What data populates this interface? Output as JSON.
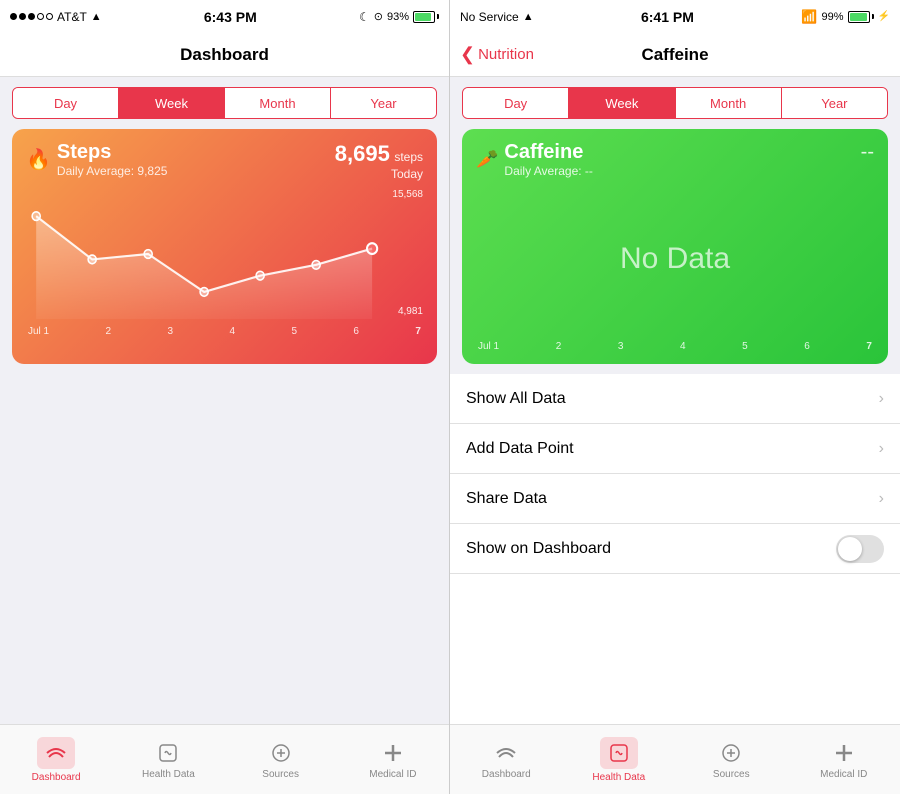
{
  "left": {
    "status": {
      "carrier": "AT&T",
      "time": "6:43 PM",
      "battery_pct": 93,
      "moon": true,
      "wifi": true
    },
    "header": {
      "title": "Dashboard"
    },
    "segments": [
      "Day",
      "Week",
      "Month",
      "Year"
    ],
    "active_segment": "Week",
    "card": {
      "icon": "🔥",
      "title": "Steps",
      "daily_avg_label": "Daily Average:",
      "daily_avg_value": "9,825",
      "value": "8,695",
      "unit": "steps",
      "date": "Today",
      "high_label": "15,568",
      "low_label": "4,981",
      "x_labels": [
        "Jul 1",
        "2",
        "3",
        "4",
        "5",
        "6",
        "7"
      ]
    },
    "tabs": [
      {
        "id": "dashboard",
        "label": "Dashboard",
        "active": true
      },
      {
        "id": "health-data",
        "label": "Health Data",
        "active": false
      },
      {
        "id": "sources",
        "label": "Sources",
        "active": false
      },
      {
        "id": "medical-id",
        "label": "Medical ID",
        "active": false
      }
    ]
  },
  "right": {
    "status": {
      "carrier": "No Service",
      "time": "6:41 PM",
      "battery_pct": 99,
      "bluetooth": true,
      "wifi": true
    },
    "nav": {
      "back_label": "Nutrition",
      "title": "Caffeine"
    },
    "segments": [
      "Day",
      "Week",
      "Month",
      "Year"
    ],
    "active_segment": "Week",
    "card": {
      "icon": "🥕",
      "title": "Caffeine",
      "daily_avg_label": "Daily Average:",
      "daily_avg_value": "--",
      "value": "--",
      "no_data_text": "No Data",
      "x_labels": [
        "Jul 1",
        "2",
        "3",
        "4",
        "5",
        "6",
        "7"
      ]
    },
    "menu_items": [
      {
        "label": "Show All Data",
        "type": "arrow"
      },
      {
        "label": "Add Data Point",
        "type": "arrow"
      },
      {
        "label": "Share Data",
        "type": "arrow"
      },
      {
        "label": "Show on Dashboard",
        "type": "toggle"
      }
    ],
    "tabs": [
      {
        "id": "dashboard",
        "label": "Dashboard",
        "active": false
      },
      {
        "id": "health-data",
        "label": "Health Data",
        "active": true
      },
      {
        "id": "sources",
        "label": "Sources",
        "active": false
      },
      {
        "id": "medical-id",
        "label": "Medical ID",
        "active": false
      }
    ]
  }
}
